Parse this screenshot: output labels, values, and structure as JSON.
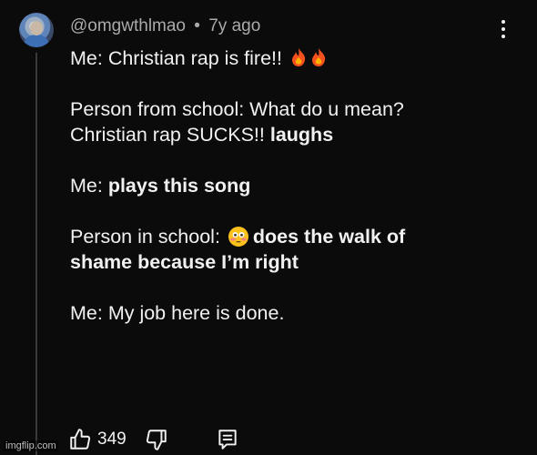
{
  "comment": {
    "username": "@omgwthlmao",
    "separator": "•",
    "age": "7y ago",
    "line1": {
      "text": "Me: Christian rap is fire!!",
      "emoji": "fire-fire"
    },
    "line2": "Person from school: What do u mean?",
    "line3_regular": "Christian rap SUCKS!! ",
    "line3_bold": "laughs",
    "line4_regular": "Me: ",
    "line4_bold": "plays this song",
    "line5_regular": "Person in school: ",
    "line5_bold": "does the walk of",
    "line6_bold": "shame because I’m right",
    "line7": "Me: My job here is done."
  },
  "actions": {
    "like_count": "349"
  },
  "watermark": "imgflip.com",
  "icons": {
    "avatar": "user-avatar",
    "menu": "more-vert-icon",
    "like": "thumbs-up-icon",
    "dislike": "thumbs-down-icon",
    "reply": "reply-comment-icon",
    "fire": "fire-emoji",
    "flushed": "flushed-face-emoji"
  },
  "colors": {
    "background": "#0b0b0b",
    "text": "#f1f1f1",
    "meta": "#aaaaaa"
  }
}
